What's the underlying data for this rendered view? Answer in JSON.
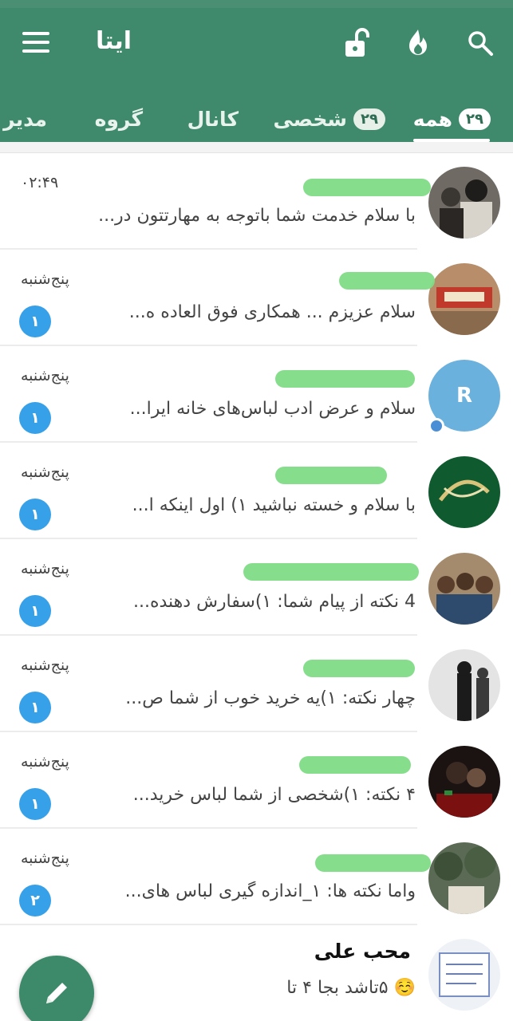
{
  "appbar": {
    "title": "ایتا",
    "icons": [
      "menu-icon",
      "lock-open-icon",
      "flame-icon",
      "search-icon"
    ]
  },
  "tabs": [
    {
      "label": "همه",
      "count": "۲۹",
      "active": true
    },
    {
      "label": "شخصی",
      "count": "۲۹",
      "active": false
    },
    {
      "label": "کانال",
      "count": "",
      "active": false
    },
    {
      "label": "گروه",
      "count": "",
      "active": false
    },
    {
      "label": "مدیر",
      "count": "",
      "active": false
    }
  ],
  "chats": [
    {
      "name": "",
      "preview": "با سلام خدمت شما باتوجه به مهارتتون در...",
      "time": "۰۲:۴۹",
      "unread": ""
    },
    {
      "name": "",
      "preview": "سلام عزیزم ... همکاری فوق العاده ه...",
      "time": "پنج‌شنبه",
      "unread": "۱"
    },
    {
      "name": "",
      "preview": "سلام و عرض ادب  لباس‌های خانه ایرا...",
      "time": "پنج‌شنبه",
      "unread": "۱",
      "avatar_letter": "R"
    },
    {
      "name": "",
      "preview": "با سلام و خسته نباشید  ۱) اول اینکه ا...",
      "time": "پنج‌شنبه",
      "unread": "۱"
    },
    {
      "name": "",
      "preview": "4 نکته از پیام شما:  ۱)سفارش دهنده...",
      "time": "پنج‌شنبه",
      "unread": "۱"
    },
    {
      "name": "",
      "preview": "چهار نکته:  ۱)یه خرید خوب از شما ص...",
      "time": "پنج‌شنبه",
      "unread": "۱"
    },
    {
      "name": "",
      "preview": "۴ نکته:  ۱)شخصی از شما لباس خرید...",
      "time": "پنج‌شنبه",
      "unread": "۱"
    },
    {
      "name": "",
      "preview": "واما نکته ها:  ۱_اندازه گیری لباس های...",
      "time": "پنج‌شنبه",
      "unread": "۲"
    },
    {
      "name": "محب علی",
      "preview": "☺️ ۵تاشد بجا ۴ تا",
      "time": "",
      "unread": ""
    }
  ],
  "colors": {
    "primary": "#3f8a6c",
    "badge": "#36a0e8",
    "redaction": "#7fdc86"
  }
}
